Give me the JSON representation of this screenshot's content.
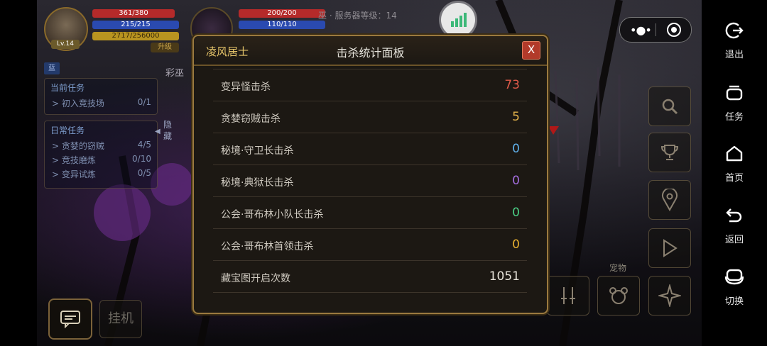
{
  "hud": {
    "hp": "361/380",
    "mp": "215/215",
    "exp": "2717/256000",
    "level": "Lv.14",
    "upgrade": "升级",
    "target_hp": "200/200",
    "target_mp": "110/110",
    "server_text": "巫 · 服务器等级：14",
    "npc_name": "彩巫"
  },
  "quests": {
    "tag": "蓝",
    "current_title": "当前任务",
    "current": [
      {
        "name": "> 初入竞技场",
        "progress": "0/1"
      }
    ],
    "daily_title": "日常任务",
    "daily": [
      {
        "name": "> 贪婪的窃贼",
        "progress": "4/5"
      },
      {
        "name": "> 竞技磨炼",
        "progress": "0/10"
      },
      {
        "name": "> 变异试炼",
        "progress": "0/5"
      }
    ],
    "hide_label": "隐藏"
  },
  "panel": {
    "player_name": "凌风居士",
    "title": "击杀统计面板",
    "close_label": "X",
    "rows": [
      {
        "label": "变异怪击杀",
        "value": "73",
        "color": "#e05a4a"
      },
      {
        "label": "贪婪窃贼击杀",
        "value": "5",
        "color": "#e2b24a"
      },
      {
        "label": "秘境·守卫长击杀",
        "value": "0",
        "color": "#5fb0ea"
      },
      {
        "label": "秘境·典狱长击杀",
        "value": "0",
        "color": "#a46ee0"
      },
      {
        "label": "公会·哥布林小队长击杀",
        "value": "0",
        "color": "#4ccf86"
      },
      {
        "label": "公会·哥布林首领击杀",
        "value": "0",
        "color": "#e8b030"
      },
      {
        "label": "藏宝图开启次数",
        "value": "1051",
        "color": "#e8e4da"
      }
    ]
  },
  "bottom": {
    "hangup": "挂机",
    "pet": "宠物"
  },
  "right_bar": [
    {
      "label": "退出",
      "icon": "exit-icon"
    },
    {
      "label": "任务",
      "icon": "task-icon"
    },
    {
      "label": "首页",
      "icon": "home-icon"
    },
    {
      "label": "返回",
      "icon": "back-icon"
    },
    {
      "label": "切换",
      "icon": "switch-icon"
    }
  ]
}
